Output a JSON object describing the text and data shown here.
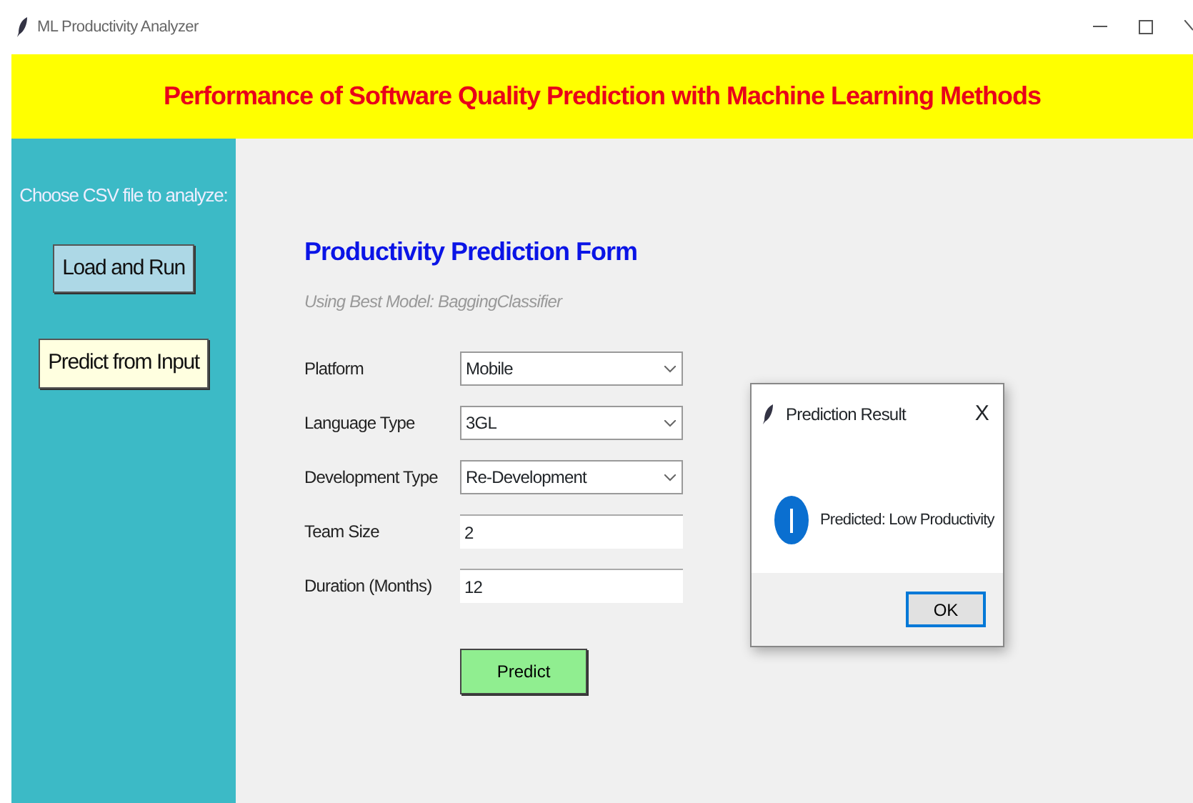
{
  "window": {
    "title": "ML Productivity Analyzer"
  },
  "banner": {
    "text": "Performance of Software Quality Prediction with Machine Learning Methods"
  },
  "sidebar": {
    "prompt": "Choose CSV file to analyze:",
    "buttons": [
      {
        "label": "Load and Run",
        "kind": "load"
      },
      {
        "label": "Predict from Input",
        "kind": "predict"
      }
    ]
  },
  "form": {
    "title": "Productivity Prediction Form",
    "subtitle": "Using Best Model: BaggingClassifier",
    "fields": [
      {
        "label": "Platform",
        "kind": "select",
        "value": "Mobile"
      },
      {
        "label": "Language Type",
        "kind": "select",
        "value": "3GL"
      },
      {
        "label": "Development Type",
        "kind": "select",
        "value": "Re-Development"
      },
      {
        "label": "Team Size",
        "kind": "text",
        "value": "2"
      },
      {
        "label": "Duration (Months)",
        "kind": "text",
        "value": "12"
      }
    ],
    "submit": "Predict"
  },
  "dialog": {
    "title": "Prediction Result",
    "close": "X",
    "message": "Predicted: Low Productivity",
    "button": "OK"
  }
}
